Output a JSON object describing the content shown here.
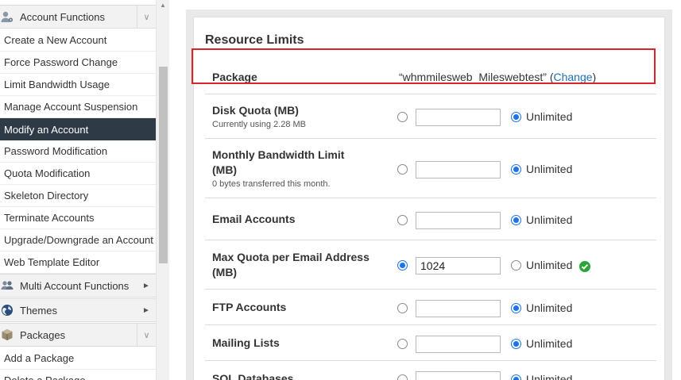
{
  "sidebar": {
    "sections": [
      {
        "label": "Account Functions",
        "icon": "user-gear-icon",
        "toggle": "∨"
      },
      {
        "label": "Multi Account Functions",
        "icon": "users-icon",
        "toggle": "►"
      },
      {
        "label": "Themes",
        "icon": "globe-icon",
        "toggle": "►"
      },
      {
        "label": "Packages",
        "icon": "package-icon",
        "toggle": "∨"
      }
    ],
    "account_items": [
      "Create a New Account",
      "Force Password Change",
      "Limit Bandwidth Usage",
      "Manage Account Suspension",
      "Modify an Account",
      "Password Modification",
      "Quota Modification",
      "Skeleton Directory",
      "Terminate Accounts",
      "Upgrade/Downgrade an Account",
      "Web Template Editor"
    ],
    "active_item": "Modify an Account",
    "package_items": [
      "Add a Package",
      "Delete a Package"
    ]
  },
  "card": {
    "title": "Resource Limits",
    "package": {
      "label": "Package",
      "value": "“whmmilesweb_Mileswebtest”",
      "open_paren": " (",
      "change_link": "Change",
      "close_paren": ")"
    },
    "unlimited_label": "Unlimited",
    "rows": [
      {
        "label_lines": [
          "Disk Quota (MB)"
        ],
        "sub": "Currently using 2.28 MB",
        "value": "",
        "value_selected": false
      },
      {
        "label_lines": [
          "Monthly Bandwidth Limit",
          "(MB)"
        ],
        "sub": "0 bytes transferred this month.",
        "value": "",
        "value_selected": false
      },
      {
        "label_lines": [
          "Email Accounts"
        ],
        "sub": "",
        "value": "",
        "value_selected": false
      },
      {
        "label_lines": [
          "Max Quota per Email Address",
          "(MB)"
        ],
        "sub": "",
        "value": "1024",
        "value_selected": true
      },
      {
        "label_lines": [
          "FTP Accounts"
        ],
        "sub": "",
        "value": "",
        "value_selected": false
      },
      {
        "label_lines": [
          "Mailing Lists"
        ],
        "sub": "",
        "value": "",
        "value_selected": false
      },
      {
        "label_lines": [
          "SQL Databases"
        ],
        "sub": "",
        "value": "",
        "value_selected": false
      }
    ]
  },
  "colors": {
    "active_bg": "#2f3a47",
    "highlight_border": "#d9232d",
    "link": "#1f6fb5",
    "radio_checked": "#1a73e8",
    "ok_green": "#2aa637"
  }
}
